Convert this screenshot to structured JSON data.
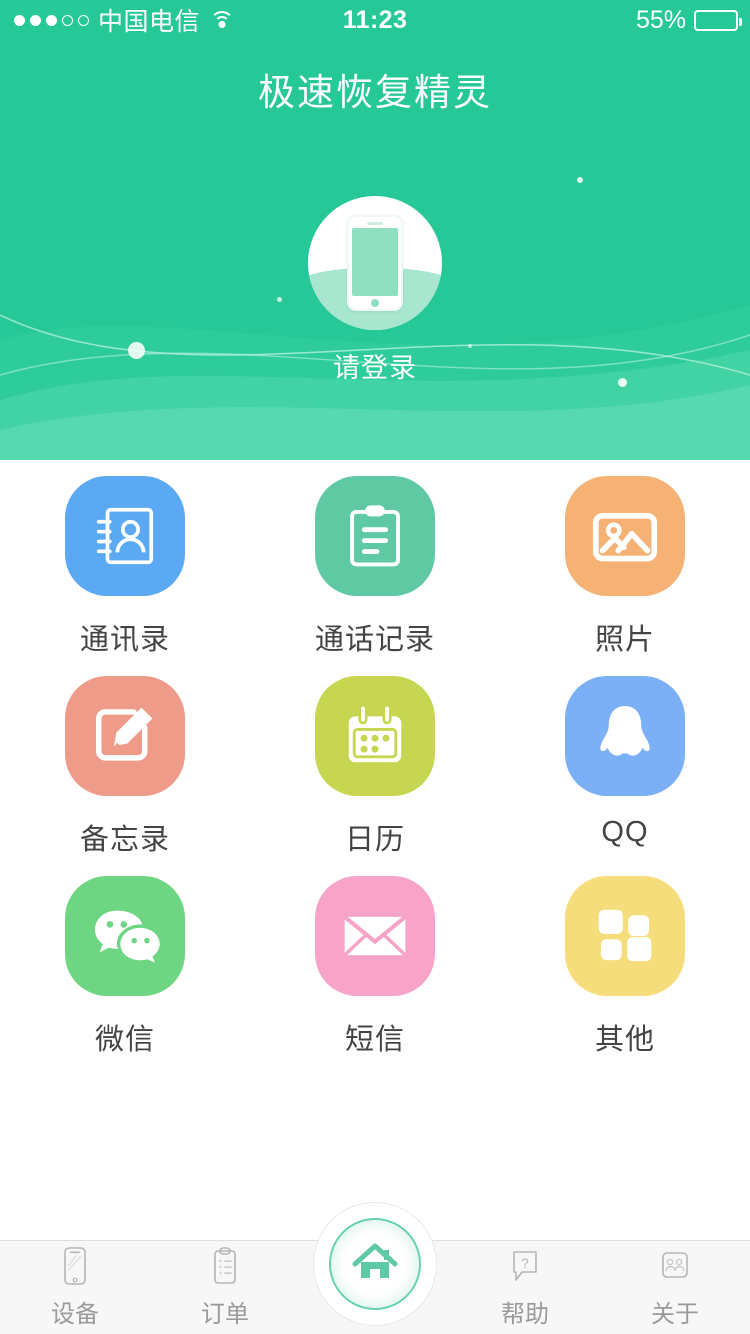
{
  "status_bar": {
    "signal_dots_filled": 3,
    "signal_dots_total": 5,
    "carrier": "中国电信",
    "wifi_icon": "wifi-icon",
    "time": "11:23",
    "battery_percent": "55%",
    "battery_level": 55,
    "battery_color": "#ffcc00"
  },
  "header": {
    "title": "极速恢复精灵",
    "background_color": "#27c897",
    "avatar_icon": "phone-avatar-icon",
    "login_label": "请登录"
  },
  "grid": {
    "items": [
      {
        "label": "通讯录",
        "icon": "contacts-icon",
        "color": "#5aa9f2"
      },
      {
        "label": "通话记录",
        "icon": "call-log-icon",
        "color": "#5fc9a3"
      },
      {
        "label": "照片",
        "icon": "photo-icon",
        "color": "#f5b274"
      },
      {
        "label": "备忘录",
        "icon": "notes-icon",
        "color": "#ef9b8a"
      },
      {
        "label": "日历",
        "icon": "calendar-icon",
        "color": "#c6d651"
      },
      {
        "label": "QQ",
        "icon": "qq-icon",
        "color": "#7bb0f7"
      },
      {
        "label": "微信",
        "icon": "wechat-icon",
        "color": "#6ed583"
      },
      {
        "label": "短信",
        "icon": "sms-icon",
        "color": "#f7a4c8"
      },
      {
        "label": "其他",
        "icon": "other-icon",
        "color": "#f6dd7c"
      }
    ]
  },
  "tabbar": {
    "items": [
      {
        "label": "设备",
        "icon": "device-icon"
      },
      {
        "label": "订单",
        "icon": "order-icon"
      },
      {
        "label": "帮助",
        "icon": "help-icon"
      },
      {
        "label": "关于",
        "icon": "about-icon"
      }
    ],
    "home_button": {
      "icon": "home-icon",
      "color": "#5fc9a3"
    },
    "label_color": "#9a9a9a"
  }
}
